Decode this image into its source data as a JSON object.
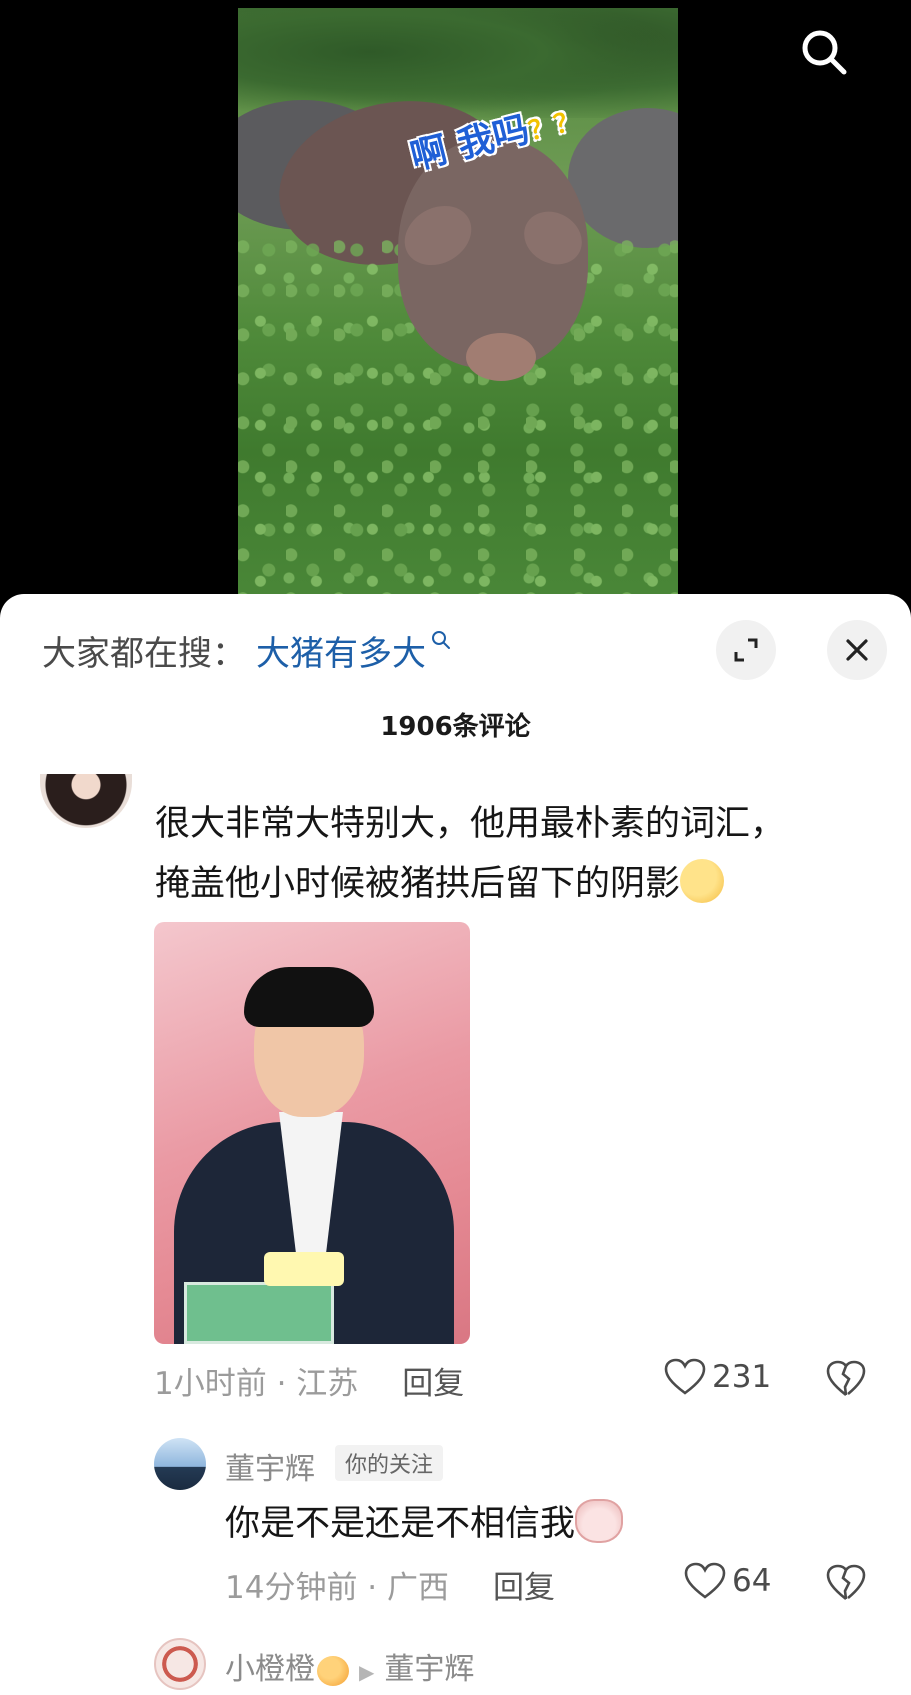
{
  "video": {
    "caption_text": "啊 我吗",
    "caption_mark": "？？",
    "search_icon": "search-icon"
  },
  "comments_panel": {
    "trending_prefix": "大家都在搜：",
    "trending_term": "大猪有多大",
    "trending_icon": "search-small-icon",
    "expand_icon": "expand-icon",
    "close_icon": "close-icon",
    "comment_count": "1906条评论",
    "comments": [
      {
        "text_line1": "很大非常大特别大，他用最朴素的词汇，",
        "text_line2": "掩盖他小时候被猪拱后留下的阴影",
        "emoji": "smirk-emoji",
        "time_location": "1小时前 · 江苏",
        "reply_label": "回复",
        "likes": "231"
      },
      {
        "username": "董宇辉",
        "tag": "你的关注",
        "text": "你是不是还是不相信我",
        "emoji": "cat-emoji",
        "time_location": "14分钟前 · 广西",
        "reply_label": "回复",
        "likes": "64"
      },
      {
        "username": "小橙橙",
        "reply_to": "董宇辉",
        "emoji": "orange-emoji"
      }
    ]
  }
}
